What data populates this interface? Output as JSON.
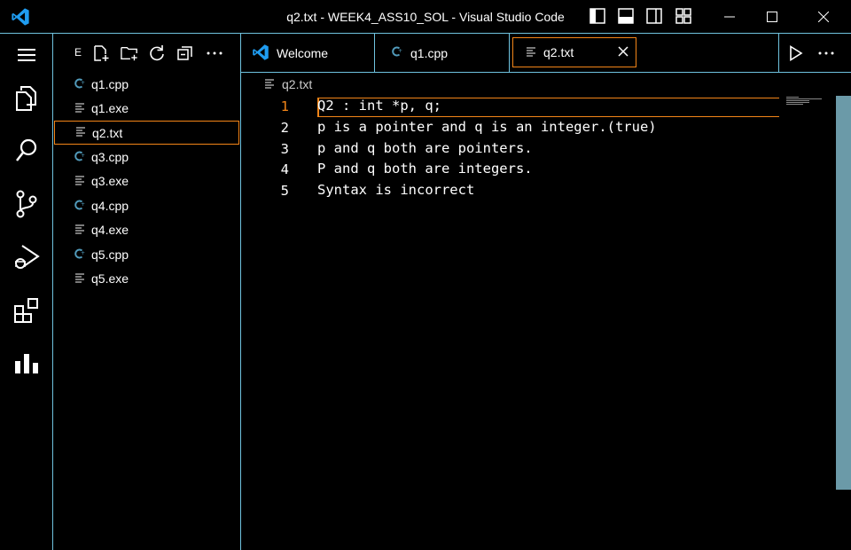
{
  "window": {
    "title": "q2.txt - WEEK4_ASS10_SOL - Visual Studio Code"
  },
  "icons": {
    "app": "vscode-logo-icon",
    "layout": [
      "toggle-primary-sidebar-icon",
      "toggle-panel-icon",
      "toggle-secondary-sidebar-icon",
      "customize-layout-icon"
    ],
    "window": [
      "minimize-icon",
      "maximize-icon",
      "close-icon"
    ]
  },
  "activity_bar": [
    "menu-icon",
    "explorer-icon",
    "search-icon",
    "source-control-icon",
    "run-debug-icon",
    "extensions-icon",
    "charts-icon"
  ],
  "sidebar": {
    "header": "E",
    "tools": [
      "new-file-icon",
      "new-folder-icon",
      "refresh-icon",
      "collapse-all-icon",
      "more-icon"
    ],
    "files": [
      {
        "name": "q1.cpp",
        "type": "cpp"
      },
      {
        "name": "q1.exe",
        "type": "file"
      },
      {
        "name": "q2.txt",
        "type": "file",
        "selected": true
      },
      {
        "name": "q3.cpp",
        "type": "cpp"
      },
      {
        "name": "q3.exe",
        "type": "file"
      },
      {
        "name": "q4.cpp",
        "type": "cpp"
      },
      {
        "name": "q4.exe",
        "type": "file"
      },
      {
        "name": "q5.cpp",
        "type": "cpp"
      },
      {
        "name": "q5.exe",
        "type": "file"
      }
    ]
  },
  "tabs": [
    {
      "label": "Welcome",
      "icon": "vscode-logo-icon"
    },
    {
      "label": "q1.cpp",
      "icon": "cpp-file-icon"
    },
    {
      "label": "q2.txt",
      "icon": "text-file-icon",
      "active": true
    }
  ],
  "breadcrumb": "q2.txt",
  "editor": {
    "current_line": 1,
    "lines": [
      {
        "number": "1",
        "text": "Q2 : int *p, q;"
      },
      {
        "number": "2",
        "text": "p is a pointer and q is an integer.(true)"
      },
      {
        "number": "3",
        "text": "p and q both are pointers."
      },
      {
        "number": "4",
        "text": "P and q both are integers."
      },
      {
        "number": "5",
        "text": "Syntax is incorrect"
      }
    ]
  },
  "colors": {
    "accent_border": "#6fc3df",
    "focus_border": "#f38518",
    "cpp_icon": "#519aba",
    "scrollbar": "#6b9aa8"
  }
}
